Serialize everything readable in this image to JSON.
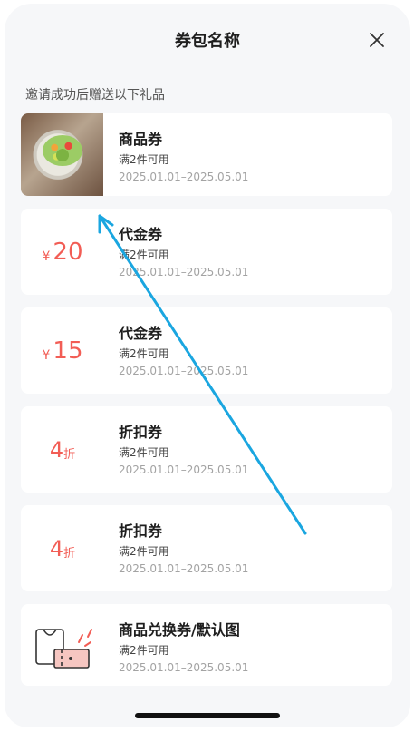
{
  "header": {
    "title": "券包名称",
    "close_icon": "close-icon"
  },
  "subtitle": "邀请成功后赠送以下礼品",
  "coupons": [
    {
      "kind": "image",
      "name": "商品券",
      "condition": "满2件可用",
      "validity": "2025.01.01–2025.05.01"
    },
    {
      "kind": "cash",
      "currency": "¥",
      "value": "20",
      "name": "代金券",
      "condition": "满2件可用",
      "validity": "2025.01.01–2025.05.01"
    },
    {
      "kind": "cash",
      "currency": "¥",
      "value": "15",
      "name": "代金券",
      "condition": "满2件可用",
      "validity": "2025.01.01–2025.05.01"
    },
    {
      "kind": "discount",
      "value": "4",
      "unit": "折",
      "name": "折扣券",
      "condition": "满2件可用",
      "validity": "2025.01.01–2025.05.01"
    },
    {
      "kind": "discount",
      "value": "4",
      "unit": "折",
      "name": "折扣券",
      "condition": "满2件可用",
      "validity": "2025.01.01–2025.05.01"
    },
    {
      "kind": "exchange",
      "name": "商品兑换券/默认图",
      "condition": "满2件可用",
      "validity": "2025.01.01–2025.05.01"
    }
  ],
  "colors": {
    "accent": "#f25d55",
    "annotation_arrow": "#1aa6e0",
    "background": "#f6f7f9"
  }
}
